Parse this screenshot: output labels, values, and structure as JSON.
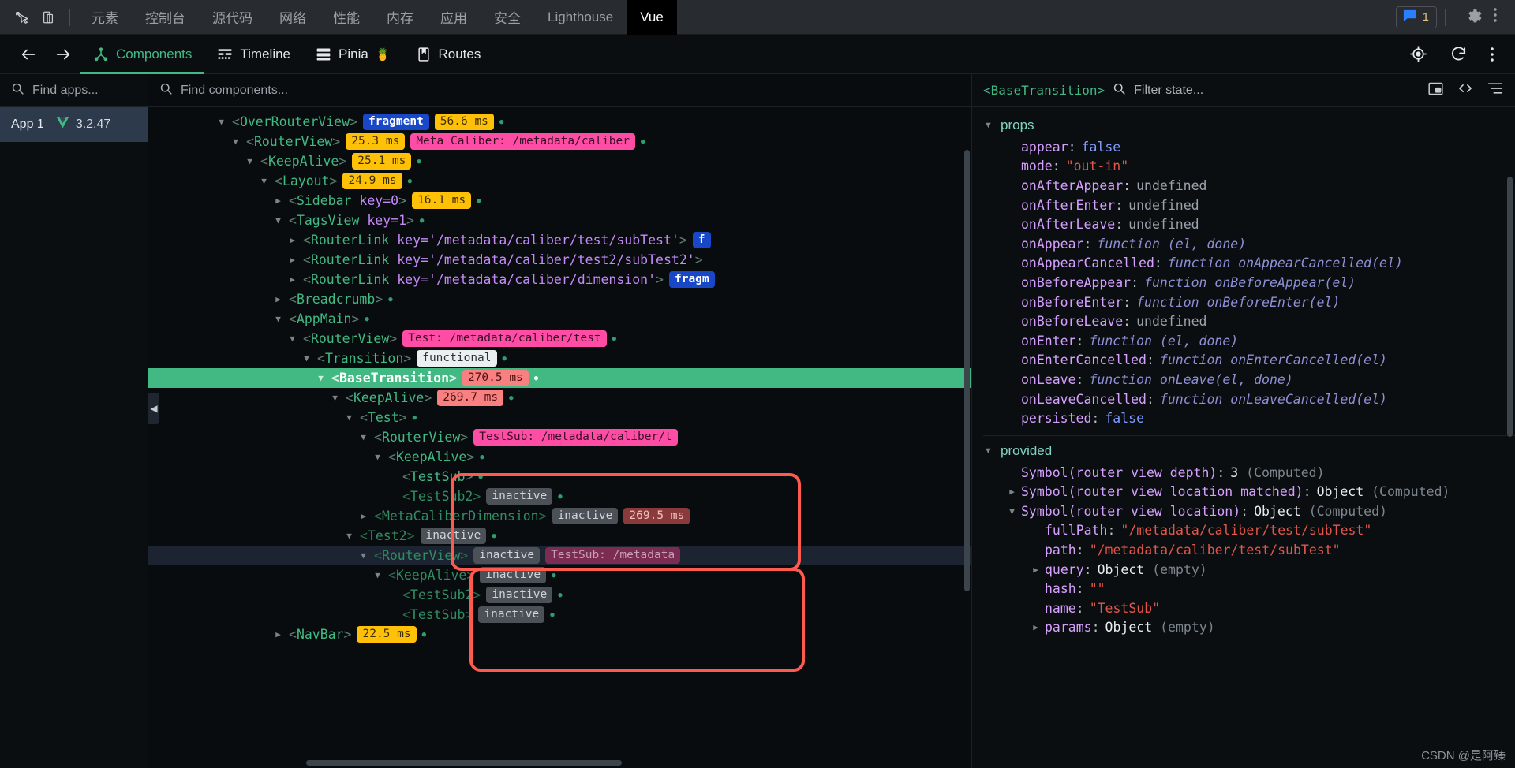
{
  "devtools_bar": {
    "icons": [
      "inspect-element-icon",
      "device-toolbar-icon"
    ],
    "tabs": [
      {
        "label": "元素",
        "active": false
      },
      {
        "label": "控制台",
        "active": false
      },
      {
        "label": "源代码",
        "active": false
      },
      {
        "label": "网络",
        "active": false
      },
      {
        "label": "性能",
        "active": false
      },
      {
        "label": "内存",
        "active": false
      },
      {
        "label": "应用",
        "active": false
      },
      {
        "label": "安全",
        "active": false
      },
      {
        "label": "Lighthouse",
        "active": false
      },
      {
        "label": "Vue",
        "active": true
      }
    ],
    "message_count": "1",
    "settings_icon": "gear-icon",
    "more_icon": "kebab-menu-icon"
  },
  "vue_toolbar": {
    "back_icon": "arrow-left-icon",
    "forward_icon": "arrow-right-icon",
    "tabs": [
      {
        "label": "Components",
        "icon": "components-icon",
        "active": true,
        "emoji": ""
      },
      {
        "label": "Timeline",
        "icon": "timeline-icon",
        "active": false,
        "emoji": ""
      },
      {
        "label": "Pinia",
        "icon": "pinia-icon",
        "active": false,
        "emoji": "🍍"
      },
      {
        "label": "Routes",
        "icon": "routes-icon",
        "active": false,
        "emoji": ""
      }
    ],
    "right_icons": [
      "target-inspect-icon",
      "refresh-icon",
      "kebab-menu-icon"
    ]
  },
  "apps_pane": {
    "search_placeholder": "Find apps...",
    "search_icon": "search-icon",
    "selected_app": {
      "name": "App 1",
      "version": "3.2.47",
      "logo": "vue-logo-icon"
    }
  },
  "tree_pane": {
    "search_placeholder": "Find components...",
    "search_icon": "search-icon",
    "rows": [
      {
        "indent": 4,
        "caret": "open",
        "tag": "OverRouterView",
        "attr": "",
        "badges": [
          {
            "text": "fragment",
            "type": "fragment"
          },
          {
            "text": "56.6 ms",
            "type": "ms-y"
          }
        ],
        "dot": true,
        "selected": false,
        "dim": false
      },
      {
        "indent": 5,
        "caret": "open",
        "tag": "RouterView",
        "attr": "",
        "badges": [
          {
            "text": "25.3 ms",
            "type": "ms-y"
          },
          {
            "text": "Meta_Caliber: /metadata/caliber",
            "type": "route"
          }
        ],
        "dot": true,
        "selected": false,
        "dim": false
      },
      {
        "indent": 6,
        "caret": "open",
        "tag": "KeepAlive",
        "attr": "",
        "badges": [
          {
            "text": "25.1 ms",
            "type": "ms-y"
          }
        ],
        "dot": true,
        "selected": false,
        "dim": false
      },
      {
        "indent": 7,
        "caret": "open",
        "tag": "Layout",
        "attr": "",
        "badges": [
          {
            "text": "24.9 ms",
            "type": "ms-y"
          }
        ],
        "dot": true,
        "selected": false,
        "dim": false
      },
      {
        "indent": 8,
        "caret": "closed",
        "tag": "Sidebar",
        "attr": "key=0",
        "badges": [
          {
            "text": "16.1 ms",
            "type": "ms-y"
          }
        ],
        "dot": true,
        "selected": false,
        "dim": false
      },
      {
        "indent": 8,
        "caret": "open",
        "tag": "TagsView",
        "attr": "key=1",
        "badges": [],
        "dot": true,
        "selected": false,
        "dim": false
      },
      {
        "indent": 9,
        "caret": "closed",
        "tag": "RouterLink",
        "attr": "key='/metadata/caliber/test/subTest'",
        "badges": [
          {
            "text": "f",
            "type": "fragment"
          }
        ],
        "dot": false,
        "selected": false,
        "dim": false
      },
      {
        "indent": 9,
        "caret": "closed",
        "tag": "RouterLink",
        "attr": "key='/metadata/caliber/test2/subTest2'",
        "badges": [],
        "dot": false,
        "selected": false,
        "dim": false
      },
      {
        "indent": 9,
        "caret": "closed",
        "tag": "RouterLink",
        "attr": "key='/metadata/caliber/dimension'",
        "badges": [
          {
            "text": "fragm",
            "type": "fragment"
          }
        ],
        "dot": false,
        "selected": false,
        "dim": false
      },
      {
        "indent": 8,
        "caret": "closed",
        "tag": "Breadcrumb",
        "attr": "",
        "badges": [],
        "dot": true,
        "selected": false,
        "dim": false
      },
      {
        "indent": 8,
        "caret": "open",
        "tag": "AppMain",
        "attr": "",
        "badges": [],
        "dot": true,
        "selected": false,
        "dim": false
      },
      {
        "indent": 9,
        "caret": "open",
        "tag": "RouterView",
        "attr": "",
        "badges": [
          {
            "text": "Test: /metadata/caliber/test",
            "type": "route"
          }
        ],
        "dot": true,
        "selected": false,
        "dim": false
      },
      {
        "indent": 10,
        "caret": "open",
        "tag": "Transition",
        "attr": "",
        "badges": [
          {
            "text": "functional",
            "type": "func"
          }
        ],
        "dot": true,
        "selected": false,
        "dim": false
      },
      {
        "indent": 11,
        "caret": "open",
        "tag": "BaseTransition",
        "attr": "",
        "badges": [
          {
            "text": "270.5 ms",
            "type": "ms-r"
          }
        ],
        "dot": true,
        "selected": true,
        "dim": false
      },
      {
        "indent": 12,
        "caret": "open",
        "tag": "KeepAlive",
        "attr": "",
        "badges": [
          {
            "text": "269.7 ms",
            "type": "ms-r"
          }
        ],
        "dot": true,
        "selected": false,
        "dim": false
      },
      {
        "indent": 13,
        "caret": "open",
        "tag": "Test",
        "attr": "",
        "badges": [],
        "dot": true,
        "selected": false,
        "dim": false
      },
      {
        "indent": 14,
        "caret": "open",
        "tag": "RouterView",
        "attr": "",
        "badges": [
          {
            "text": "TestSub: /metadata/caliber/t",
            "type": "route"
          }
        ],
        "dot": false,
        "selected": false,
        "dim": false
      },
      {
        "indent": 15,
        "caret": "open",
        "tag": "KeepAlive",
        "attr": "",
        "badges": [],
        "dot": true,
        "selected": false,
        "dim": false
      },
      {
        "indent": 16,
        "caret": "none",
        "tag": "TestSub",
        "attr": "",
        "badges": [],
        "dot": true,
        "selected": false,
        "dim": false
      },
      {
        "indent": 16,
        "caret": "none",
        "tag": "TestSub2",
        "attr": "",
        "badges": [
          {
            "text": "inactive",
            "type": "inactive"
          }
        ],
        "dot": true,
        "selected": false,
        "dim": true
      },
      {
        "indent": 14,
        "caret": "closed",
        "tag": "MetaCaliberDimension",
        "attr": "",
        "badges": [
          {
            "text": "inactive",
            "type": "inactive"
          },
          {
            "text": "269.5 ms",
            "type": "ms-dk"
          }
        ],
        "dot": false,
        "selected": false,
        "dim": true
      },
      {
        "indent": 13,
        "caret": "open",
        "tag": "Test2",
        "attr": "",
        "badges": [
          {
            "text": "inactive",
            "type": "inactive"
          }
        ],
        "dot": true,
        "selected": false,
        "dim": true
      },
      {
        "indent": 14,
        "caret": "open",
        "tag": "RouterView",
        "attr": "",
        "badges": [
          {
            "text": "inactive",
            "type": "inactive"
          },
          {
            "text": "TestSub: /metadata",
            "type": "route-dim"
          }
        ],
        "dot": false,
        "selected": false,
        "dim": true,
        "rowhl": true
      },
      {
        "indent": 15,
        "caret": "open",
        "tag": "KeepAlive",
        "attr": "",
        "badges": [
          {
            "text": "inactive",
            "type": "inactive"
          }
        ],
        "dot": true,
        "selected": false,
        "dim": true
      },
      {
        "indent": 16,
        "caret": "none",
        "tag": "TestSub2",
        "attr": "",
        "badges": [
          {
            "text": "inactive",
            "type": "inactive"
          }
        ],
        "dot": true,
        "selected": false,
        "dim": true
      },
      {
        "indent": 16,
        "caret": "none",
        "tag": "TestSub",
        "attr": "",
        "badges": [
          {
            "text": "inactive",
            "type": "inactive"
          }
        ],
        "dot": true,
        "selected": false,
        "dim": true
      },
      {
        "indent": 8,
        "caret": "closed",
        "tag": "NavBar",
        "attr": "",
        "badges": [
          {
            "text": "22.5 ms",
            "type": "ms-y"
          }
        ],
        "dot": true,
        "selected": false,
        "dim": false
      }
    ]
  },
  "state_pane": {
    "component_name": "<BaseTransition>",
    "search_placeholder": "Filter state...",
    "search_icon": "search-icon",
    "header_icons": [
      "picture-in-picture-icon",
      "code-icon",
      "collapse-all-icon"
    ],
    "sections": [
      {
        "title": "props",
        "caret": "open",
        "rows": [
          {
            "key": "appear",
            "value": "false",
            "vtype": "bool",
            "indent": 1,
            "caret": "none",
            "note": ""
          },
          {
            "key": "mode",
            "value": "\"out-in\"",
            "vtype": "str",
            "indent": 1,
            "caret": "none",
            "note": ""
          },
          {
            "key": "onAfterAppear",
            "value": "undefined",
            "vtype": "undef",
            "indent": 1,
            "caret": "none",
            "note": ""
          },
          {
            "key": "onAfterEnter",
            "value": "undefined",
            "vtype": "undef",
            "indent": 1,
            "caret": "none",
            "note": ""
          },
          {
            "key": "onAfterLeave",
            "value": "undefined",
            "vtype": "undef",
            "indent": 1,
            "caret": "none",
            "note": ""
          },
          {
            "key": "onAppear",
            "value": "function (el, done)",
            "vtype": "fn",
            "indent": 1,
            "caret": "none",
            "note": ""
          },
          {
            "key": "onAppearCancelled",
            "value": "function onAppearCancelled(el)",
            "vtype": "fn",
            "indent": 1,
            "caret": "none",
            "note": ""
          },
          {
            "key": "onBeforeAppear",
            "value": "function onBeforeAppear(el)",
            "vtype": "fn",
            "indent": 1,
            "caret": "none",
            "note": ""
          },
          {
            "key": "onBeforeEnter",
            "value": "function onBeforeEnter(el)",
            "vtype": "fn",
            "indent": 1,
            "caret": "none",
            "note": ""
          },
          {
            "key": "onBeforeLeave",
            "value": "undefined",
            "vtype": "undef",
            "indent": 1,
            "caret": "none",
            "note": ""
          },
          {
            "key": "onEnter",
            "value": "function (el, done)",
            "vtype": "fn",
            "indent": 1,
            "caret": "none",
            "note": ""
          },
          {
            "key": "onEnterCancelled",
            "value": "function onEnterCancelled(el)",
            "vtype": "fn",
            "indent": 1,
            "caret": "none",
            "note": ""
          },
          {
            "key": "onLeave",
            "value": "function onLeave(el, done)",
            "vtype": "fn",
            "indent": 1,
            "caret": "none",
            "note": ""
          },
          {
            "key": "onLeaveCancelled",
            "value": "function onLeaveCancelled(el)",
            "vtype": "fn",
            "indent": 1,
            "caret": "none",
            "note": ""
          },
          {
            "key": "persisted",
            "value": "false",
            "vtype": "bool",
            "indent": 1,
            "caret": "none",
            "note": ""
          }
        ]
      },
      {
        "title": "provided",
        "caret": "open",
        "rows": [
          {
            "key": "Symbol(router view depth)",
            "value": "3",
            "vtype": "num",
            "indent": 1,
            "caret": "none",
            "note": "(Computed)"
          },
          {
            "key": "Symbol(router view location matched)",
            "value": "Object",
            "vtype": "obj",
            "indent": 1,
            "caret": "closed",
            "note": "(Computed)"
          },
          {
            "key": "Symbol(router view location)",
            "value": "Object",
            "vtype": "obj",
            "indent": 1,
            "caret": "open",
            "note": "(Computed)"
          },
          {
            "key": "fullPath",
            "value": "\"/metadata/caliber/test/subTest\"",
            "vtype": "str",
            "indent": 2,
            "caret": "none",
            "note": ""
          },
          {
            "key": "path",
            "value": "\"/metadata/caliber/test/subTest\"",
            "vtype": "str",
            "indent": 2,
            "caret": "none",
            "note": ""
          },
          {
            "key": "query",
            "value": "Object",
            "vtype": "obj",
            "indent": 2,
            "caret": "closed",
            "note": "(empty)"
          },
          {
            "key": "hash",
            "value": "\"\"",
            "vtype": "str",
            "indent": 2,
            "caret": "none",
            "note": ""
          },
          {
            "key": "name",
            "value": "\"TestSub\"",
            "vtype": "str",
            "indent": 2,
            "caret": "none",
            "note": ""
          },
          {
            "key": "params",
            "value": "Object",
            "vtype": "obj",
            "indent": 2,
            "caret": "closed",
            "note": "(empty)"
          }
        ]
      }
    ]
  },
  "watermark": "CSDN @是阿臻",
  "annotations": [
    {
      "name": "red-box-upper"
    },
    {
      "name": "red-box-lower"
    }
  ]
}
